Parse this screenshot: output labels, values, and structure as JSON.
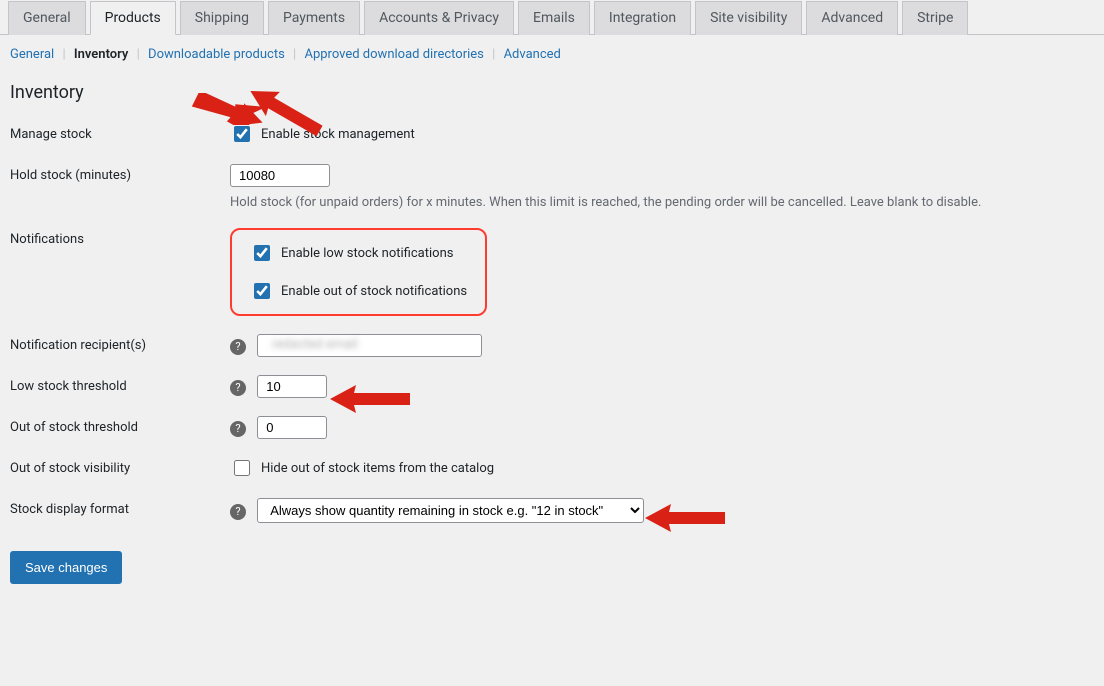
{
  "tabs": {
    "main": [
      {
        "label": "General",
        "active": false
      },
      {
        "label": "Products",
        "active": true
      },
      {
        "label": "Shipping",
        "active": false
      },
      {
        "label": "Payments",
        "active": false
      },
      {
        "label": "Accounts & Privacy",
        "active": false
      },
      {
        "label": "Emails",
        "active": false
      },
      {
        "label": "Integration",
        "active": false
      },
      {
        "label": "Site visibility",
        "active": false
      },
      {
        "label": "Advanced",
        "active": false
      },
      {
        "label": "Stripe",
        "active": false
      }
    ],
    "sub": [
      {
        "label": "General",
        "current": false
      },
      {
        "label": "Inventory",
        "current": true
      },
      {
        "label": "Downloadable products",
        "current": false
      },
      {
        "label": "Approved download directories",
        "current": false
      },
      {
        "label": "Advanced",
        "current": false
      }
    ]
  },
  "heading": "Inventory",
  "fields": {
    "manage_stock": {
      "label": "Manage stock",
      "checkbox_label": "Enable stock management",
      "checked": true
    },
    "hold_stock": {
      "label": "Hold stock (minutes)",
      "value": "10080",
      "description": "Hold stock (for unpaid orders) for x minutes. When this limit is reached, the pending order will be cancelled. Leave blank to disable."
    },
    "notifications": {
      "label": "Notifications",
      "low_stock_label": "Enable low stock notifications",
      "low_stock_checked": true,
      "out_of_stock_label": "Enable out of stock notifications",
      "out_of_stock_checked": true
    },
    "recipients": {
      "label": "Notification recipient(s)",
      "value": ""
    },
    "low_threshold": {
      "label": "Low stock threshold",
      "value": "10"
    },
    "oos_threshold": {
      "label": "Out of stock threshold",
      "value": "0"
    },
    "oos_visibility": {
      "label": "Out of stock visibility",
      "checkbox_label": "Hide out of stock items from the catalog",
      "checked": false
    },
    "display_format": {
      "label": "Stock display format",
      "selected": "Always show quantity remaining in stock e.g. \"12 in stock\""
    }
  },
  "submit": {
    "label": "Save changes"
  }
}
